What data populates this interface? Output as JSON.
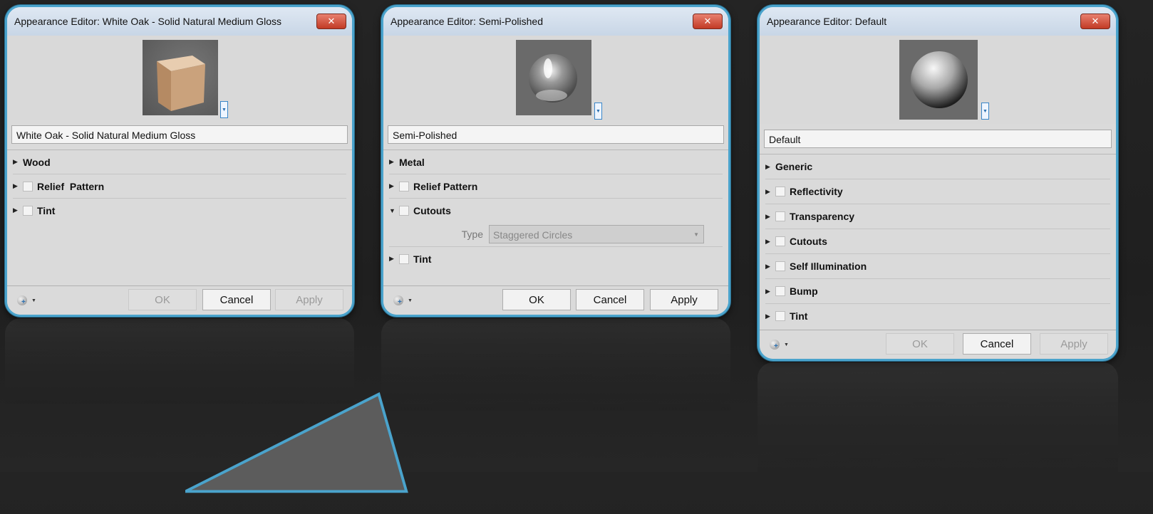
{
  "dialogs": [
    {
      "title": "Appearance Editor: White Oak - Solid Natural Medium Gloss",
      "close_label": "✕",
      "name_value": "White Oak - Solid Natural Medium Gloss",
      "sections": [
        {
          "label": "Wood",
          "checkbox": false
        },
        {
          "label": "Relief  Pattern",
          "checkbox": true
        },
        {
          "label": "Tint",
          "checkbox": true
        }
      ],
      "buttons": {
        "ok": "OK",
        "cancel": "Cancel",
        "apply": "Apply"
      },
      "disabled": {
        "ok": true,
        "cancel": false,
        "apply": true
      }
    },
    {
      "title": "Appearance Editor: Semi-Polished",
      "close_label": "✕",
      "name_value": "Semi-Polished",
      "sections": [
        {
          "label": "Metal",
          "checkbox": false
        },
        {
          "label": "Relief Pattern",
          "checkbox": true
        },
        {
          "label": "Cutouts",
          "checkbox": true,
          "expanded": true
        },
        {
          "label": "Tint",
          "checkbox": true
        }
      ],
      "cutouts_type_label": "Type",
      "cutouts_type_value": "Staggered Circles",
      "buttons": {
        "ok": "OK",
        "cancel": "Cancel",
        "apply": "Apply"
      },
      "disabled": {
        "ok": false,
        "cancel": false,
        "apply": false
      }
    },
    {
      "title": "Appearance Editor: Default",
      "close_label": "✕",
      "name_value": "Default",
      "sections": [
        {
          "label": "Generic",
          "checkbox": false
        },
        {
          "label": "Reflectivity",
          "checkbox": true
        },
        {
          "label": "Transparency",
          "checkbox": true
        },
        {
          "label": "Cutouts",
          "checkbox": true
        },
        {
          "label": "Self Illumination",
          "checkbox": true
        },
        {
          "label": "Bump",
          "checkbox": true
        },
        {
          "label": "Tint",
          "checkbox": true
        }
      ],
      "buttons": {
        "ok": "OK",
        "cancel": "Cancel",
        "apply": "Apply"
      },
      "disabled": {
        "ok": true,
        "cancel": false,
        "apply": true
      }
    }
  ],
  "icons": {
    "close": "close-icon",
    "expand": "triangle-right-icon",
    "expanded": "triangle-down-icon",
    "dropdown": "chevron-down-icon",
    "globe": "globe-plus-icon"
  },
  "colors": {
    "accent": "#4aa3cc",
    "close": "#c23a25",
    "dialog_bg": "#dadada"
  }
}
